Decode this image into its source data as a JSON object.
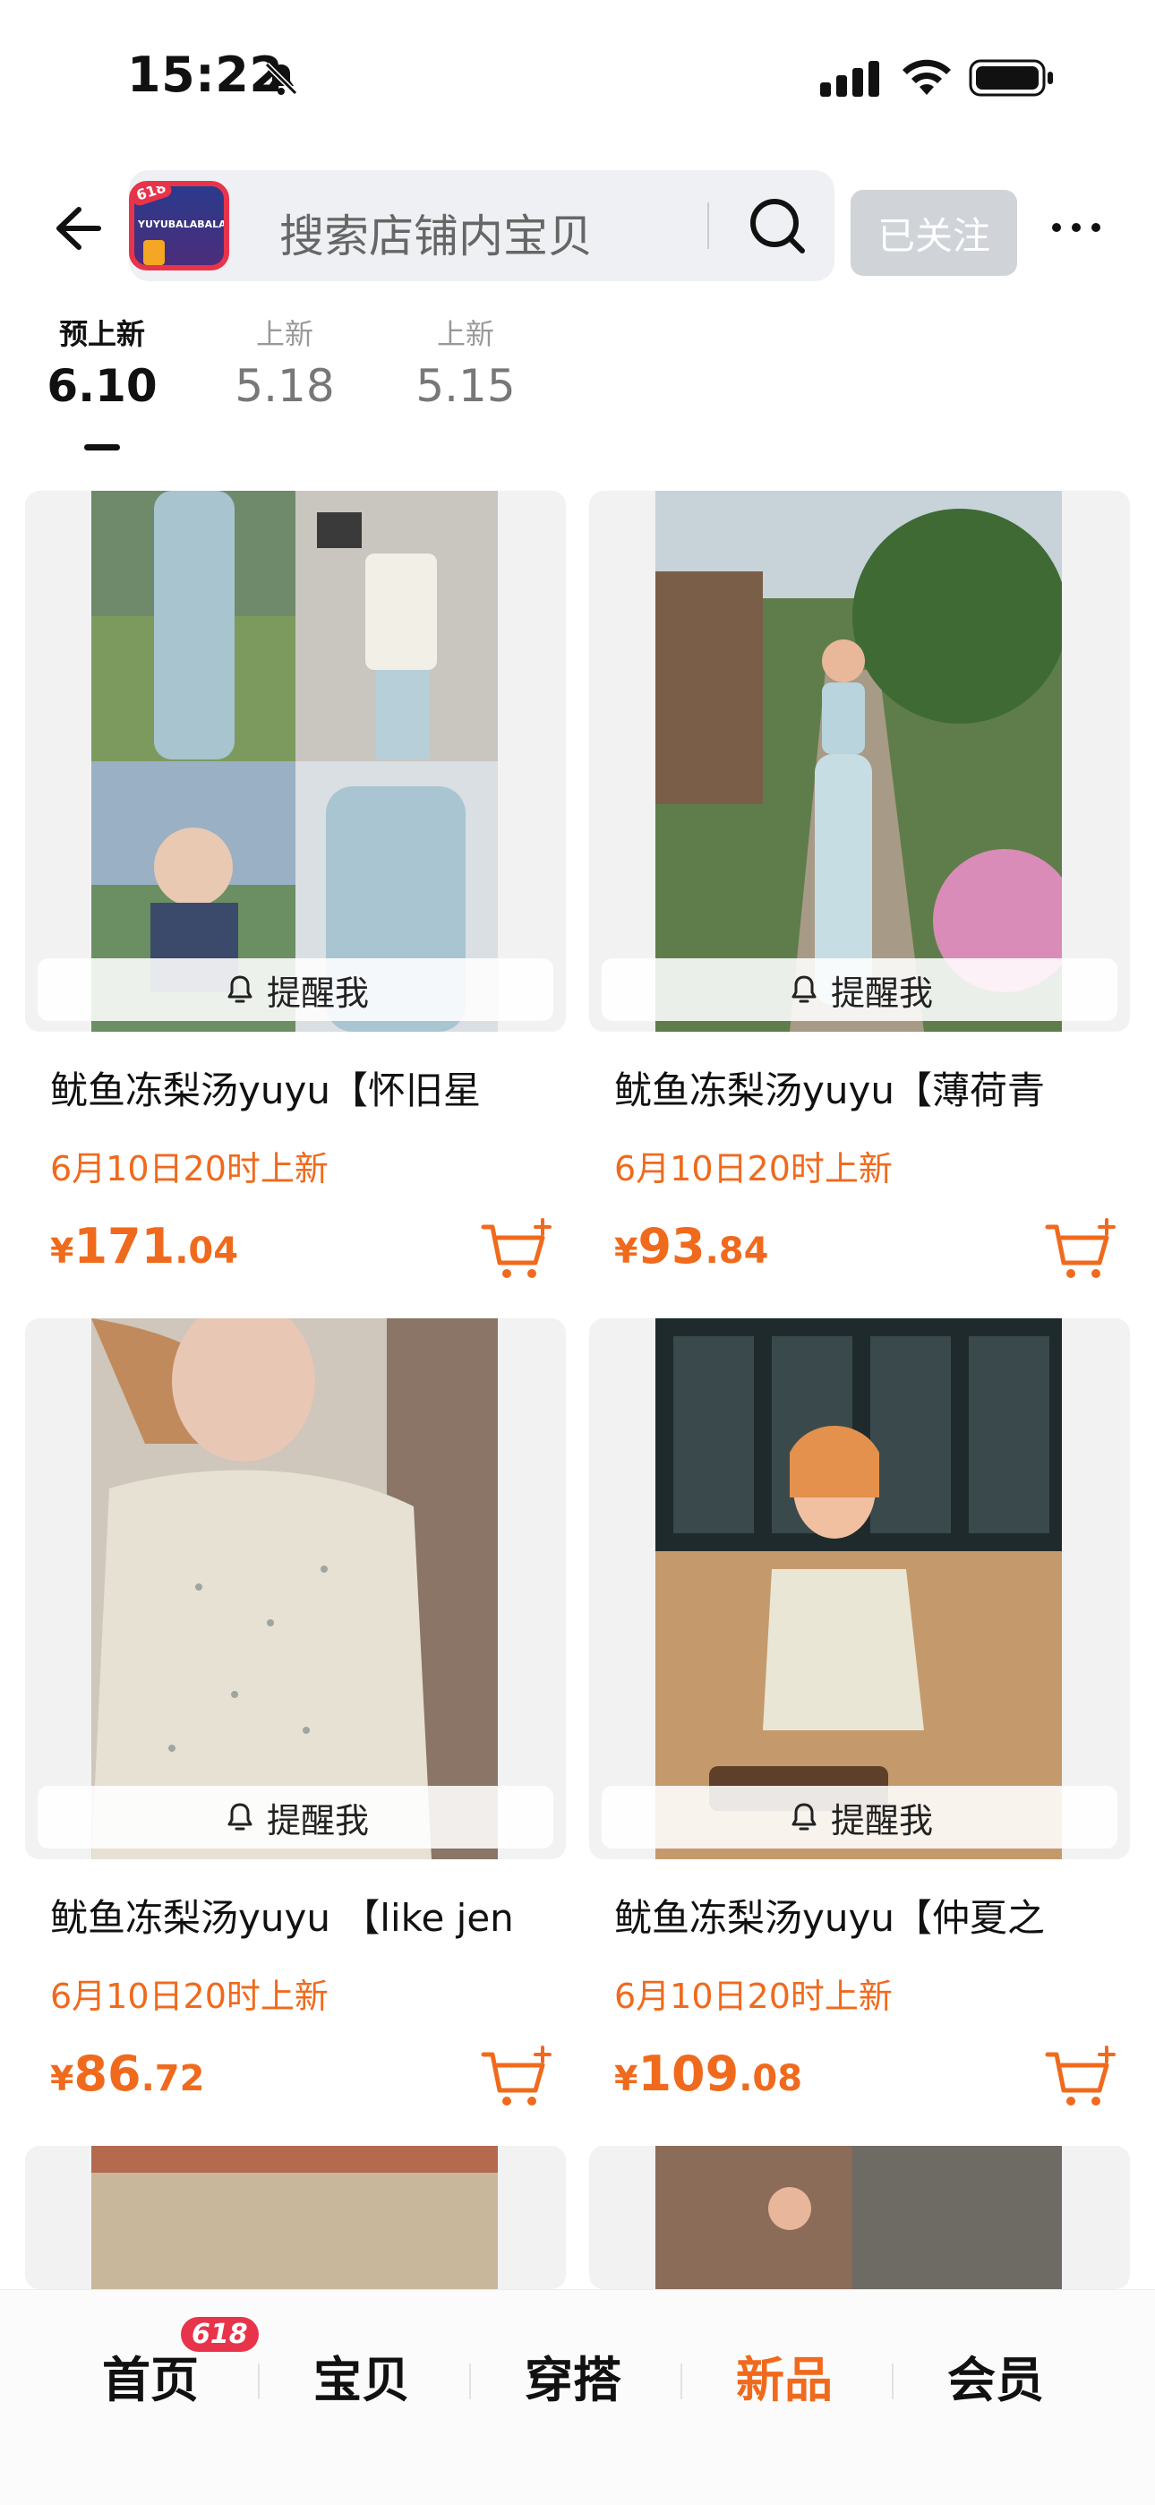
{
  "status_bar": {
    "time": "15:22"
  },
  "header": {
    "search_placeholder": "搜索店铺内宝贝",
    "follow_label": "已关注",
    "shop_logo_text": "YUYUBALABALA",
    "shop_logo_badge": "618"
  },
  "date_tabs": [
    {
      "label": "预上新",
      "date": "6.10",
      "active": true
    },
    {
      "label": "上新",
      "date": "5.18",
      "active": false
    },
    {
      "label": "上新",
      "date": "5.15",
      "active": false
    }
  ],
  "products": [
    {
      "title": "鱿鱼冻梨汤yuyu【怀旧星",
      "release": "6月10日20时上新",
      "currency": "¥",
      "price_int": "171",
      "price_dec": ".04",
      "remind": "提醒我"
    },
    {
      "title": "鱿鱼冻梨汤yuyu【薄荷青",
      "release": "6月10日20时上新",
      "currency": "¥",
      "price_int": "93",
      "price_dec": ".84",
      "remind": "提醒我"
    },
    {
      "title": "鱿鱼冻梨汤yuyu 【like jen",
      "release": "6月10日20时上新",
      "currency": "¥",
      "price_int": "86",
      "price_dec": ".72",
      "remind": "提醒我"
    },
    {
      "title": "鱿鱼冻梨汤yuyu【仲夏之",
      "release": "6月10日20时上新",
      "currency": "¥",
      "price_int": "109",
      "price_dec": ".08",
      "remind": "提醒我"
    }
  ],
  "bottom_nav": {
    "items": [
      {
        "label": "首页",
        "active": false
      },
      {
        "label": "宝贝",
        "active": false
      },
      {
        "label": "穿搭",
        "active": false
      },
      {
        "label": "新品",
        "active": true
      },
      {
        "label": "会员",
        "active": false
      }
    ],
    "badge": "618"
  },
  "colors": {
    "accent": "#f06a1d",
    "badge": "#e8344b",
    "follow_bg": "#d0d3d8"
  },
  "icons": [
    "bell-off-icon",
    "signal-icon",
    "wifi-icon",
    "battery-icon",
    "back-arrow-icon",
    "search-icon",
    "more-icon",
    "bell-icon",
    "cart-add-icon"
  ]
}
